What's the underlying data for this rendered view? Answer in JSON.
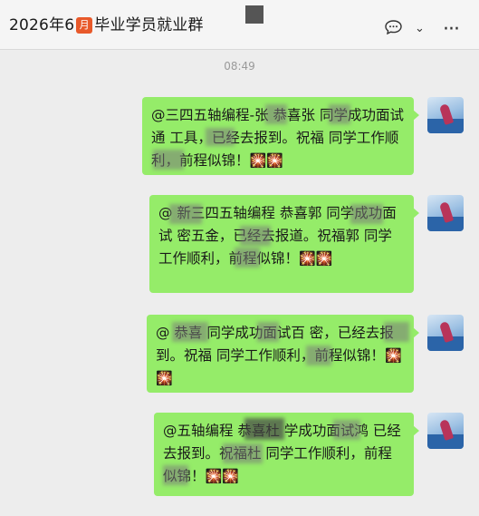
{
  "header": {
    "title_pre": "2026年6",
    "month_icon_text": "月",
    "title_post": "毕业学员就业群",
    "icons": [
      "chat-bubble-icon",
      "chevron-down-icon",
      "more-icon"
    ],
    "chevron_glyph": "⌄",
    "more_glyph": "···"
  },
  "timestamp": "08:49",
  "firework_glyph": "🎇🎇",
  "messages": [
    {
      "text": "@三四五轴编程-张 恭喜张 同学成功面试通 工具，已经去报到。祝福 同学工作顺利，前程似锦！"
    },
    {
      "text": "@ 新三四五轴编程 恭喜郭 同学成功面试 密五金，已经去报道。祝福郭 同学工作顺利，前程似锦！"
    },
    {
      "text": "@ 恭喜 同学成功面试百 密，已经去报到。祝福 同学工作顺利，前程似锦！"
    },
    {
      "text": "@五轴编程 恭喜杜 学成功面试鸿 已经去报到。祝福杜 同学工作顺利，前程似锦！"
    }
  ],
  "colors": {
    "bubble": "#95ec69",
    "background": "#ededed",
    "month_icon": "#e8592a"
  }
}
